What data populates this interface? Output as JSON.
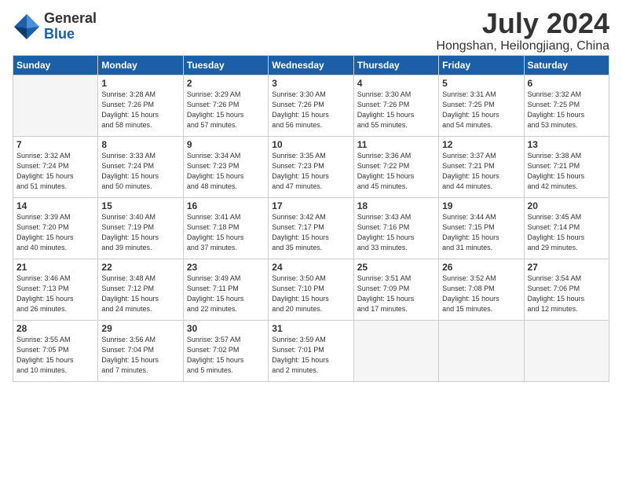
{
  "header": {
    "logo_general": "General",
    "logo_blue": "Blue",
    "month_year": "July 2024",
    "location": "Hongshan, Heilongjiang, China"
  },
  "days_of_week": [
    "Sunday",
    "Monday",
    "Tuesday",
    "Wednesday",
    "Thursday",
    "Friday",
    "Saturday"
  ],
  "weeks": [
    [
      {
        "day": "",
        "info": ""
      },
      {
        "day": "1",
        "info": "Sunrise: 3:28 AM\nSunset: 7:26 PM\nDaylight: 15 hours\nand 58 minutes."
      },
      {
        "day": "2",
        "info": "Sunrise: 3:29 AM\nSunset: 7:26 PM\nDaylight: 15 hours\nand 57 minutes."
      },
      {
        "day": "3",
        "info": "Sunrise: 3:30 AM\nSunset: 7:26 PM\nDaylight: 15 hours\nand 56 minutes."
      },
      {
        "day": "4",
        "info": "Sunrise: 3:30 AM\nSunset: 7:26 PM\nDaylight: 15 hours\nand 55 minutes."
      },
      {
        "day": "5",
        "info": "Sunrise: 3:31 AM\nSunset: 7:25 PM\nDaylight: 15 hours\nand 54 minutes."
      },
      {
        "day": "6",
        "info": "Sunrise: 3:32 AM\nSunset: 7:25 PM\nDaylight: 15 hours\nand 53 minutes."
      }
    ],
    [
      {
        "day": "7",
        "info": "Sunrise: 3:32 AM\nSunset: 7:24 PM\nDaylight: 15 hours\nand 51 minutes."
      },
      {
        "day": "8",
        "info": "Sunrise: 3:33 AM\nSunset: 7:24 PM\nDaylight: 15 hours\nand 50 minutes."
      },
      {
        "day": "9",
        "info": "Sunrise: 3:34 AM\nSunset: 7:23 PM\nDaylight: 15 hours\nand 48 minutes."
      },
      {
        "day": "10",
        "info": "Sunrise: 3:35 AM\nSunset: 7:23 PM\nDaylight: 15 hours\nand 47 minutes."
      },
      {
        "day": "11",
        "info": "Sunrise: 3:36 AM\nSunset: 7:22 PM\nDaylight: 15 hours\nand 45 minutes."
      },
      {
        "day": "12",
        "info": "Sunrise: 3:37 AM\nSunset: 7:21 PM\nDaylight: 15 hours\nand 44 minutes."
      },
      {
        "day": "13",
        "info": "Sunrise: 3:38 AM\nSunset: 7:21 PM\nDaylight: 15 hours\nand 42 minutes."
      }
    ],
    [
      {
        "day": "14",
        "info": "Sunrise: 3:39 AM\nSunset: 7:20 PM\nDaylight: 15 hours\nand 40 minutes."
      },
      {
        "day": "15",
        "info": "Sunrise: 3:40 AM\nSunset: 7:19 PM\nDaylight: 15 hours\nand 39 minutes."
      },
      {
        "day": "16",
        "info": "Sunrise: 3:41 AM\nSunset: 7:18 PM\nDaylight: 15 hours\nand 37 minutes."
      },
      {
        "day": "17",
        "info": "Sunrise: 3:42 AM\nSunset: 7:17 PM\nDaylight: 15 hours\nand 35 minutes."
      },
      {
        "day": "18",
        "info": "Sunrise: 3:43 AM\nSunset: 7:16 PM\nDaylight: 15 hours\nand 33 minutes."
      },
      {
        "day": "19",
        "info": "Sunrise: 3:44 AM\nSunset: 7:15 PM\nDaylight: 15 hours\nand 31 minutes."
      },
      {
        "day": "20",
        "info": "Sunrise: 3:45 AM\nSunset: 7:14 PM\nDaylight: 15 hours\nand 29 minutes."
      }
    ],
    [
      {
        "day": "21",
        "info": "Sunrise: 3:46 AM\nSunset: 7:13 PM\nDaylight: 15 hours\nand 26 minutes."
      },
      {
        "day": "22",
        "info": "Sunrise: 3:48 AM\nSunset: 7:12 PM\nDaylight: 15 hours\nand 24 minutes."
      },
      {
        "day": "23",
        "info": "Sunrise: 3:49 AM\nSunset: 7:11 PM\nDaylight: 15 hours\nand 22 minutes."
      },
      {
        "day": "24",
        "info": "Sunrise: 3:50 AM\nSunset: 7:10 PM\nDaylight: 15 hours\nand 20 minutes."
      },
      {
        "day": "25",
        "info": "Sunrise: 3:51 AM\nSunset: 7:09 PM\nDaylight: 15 hours\nand 17 minutes."
      },
      {
        "day": "26",
        "info": "Sunrise: 3:52 AM\nSunset: 7:08 PM\nDaylight: 15 hours\nand 15 minutes."
      },
      {
        "day": "27",
        "info": "Sunrise: 3:54 AM\nSunset: 7:06 PM\nDaylight: 15 hours\nand 12 minutes."
      }
    ],
    [
      {
        "day": "28",
        "info": "Sunrise: 3:55 AM\nSunset: 7:05 PM\nDaylight: 15 hours\nand 10 minutes."
      },
      {
        "day": "29",
        "info": "Sunrise: 3:56 AM\nSunset: 7:04 PM\nDaylight: 15 hours\nand 7 minutes."
      },
      {
        "day": "30",
        "info": "Sunrise: 3:57 AM\nSunset: 7:02 PM\nDaylight: 15 hours\nand 5 minutes."
      },
      {
        "day": "31",
        "info": "Sunrise: 3:59 AM\nSunset: 7:01 PM\nDaylight: 15 hours\nand 2 minutes."
      },
      {
        "day": "",
        "info": ""
      },
      {
        "day": "",
        "info": ""
      },
      {
        "day": "",
        "info": ""
      }
    ]
  ]
}
